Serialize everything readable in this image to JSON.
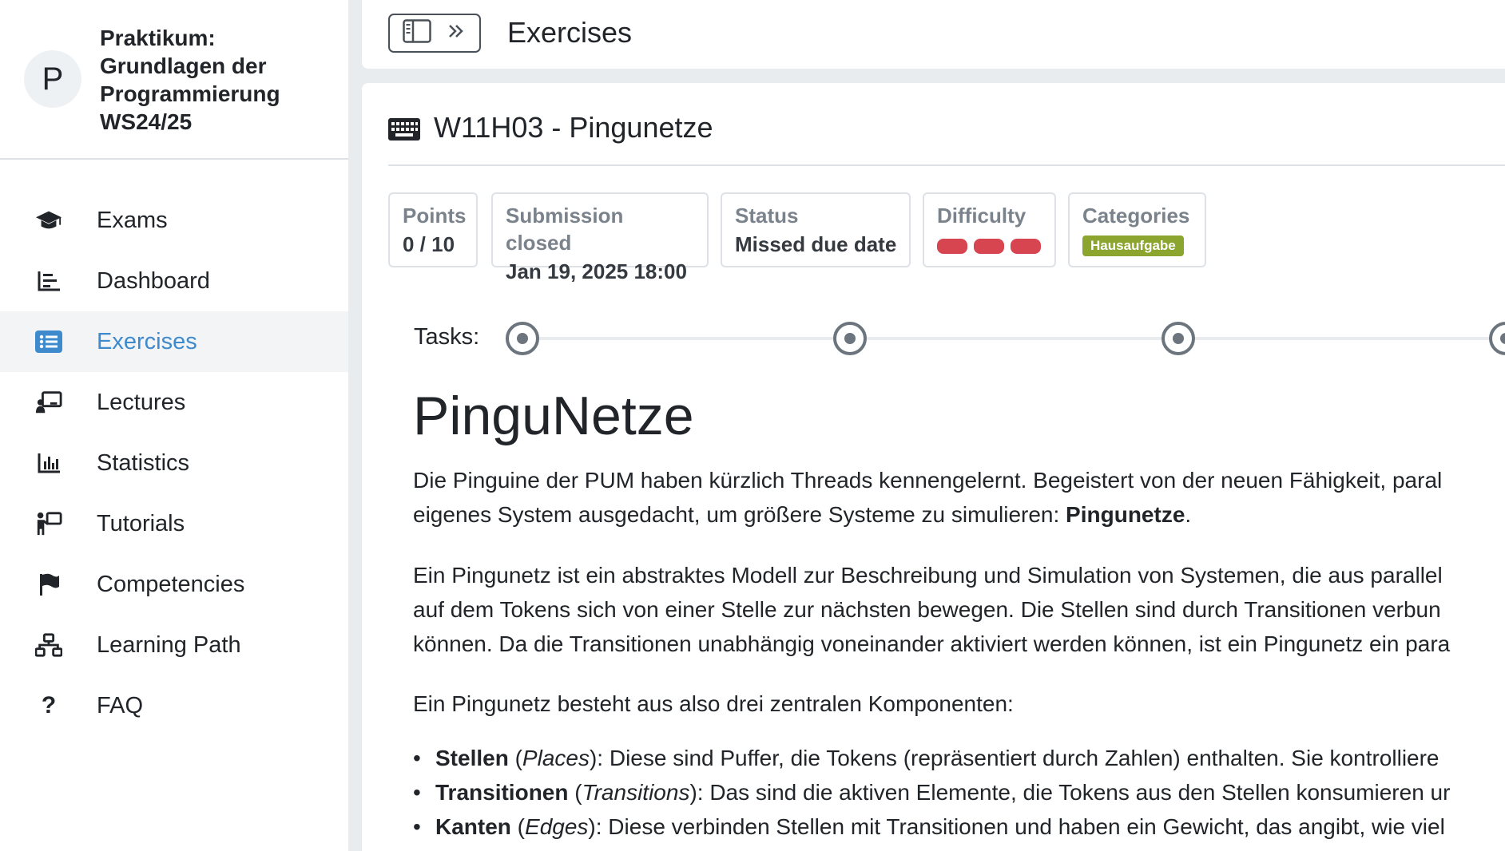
{
  "course": {
    "avatar_letter": "P",
    "title": "Praktikum: Grundlagen der Programmierung WS24/25"
  },
  "sidebar": {
    "items": [
      {
        "label": "Exams",
        "icon": "graduation-cap-icon"
      },
      {
        "label": "Dashboard",
        "icon": "chart-area-icon"
      },
      {
        "label": "Exercises",
        "icon": "list-icon",
        "active": true
      },
      {
        "label": "Lectures",
        "icon": "chalkboard-user-icon"
      },
      {
        "label": "Statistics",
        "icon": "bar-chart-icon"
      },
      {
        "label": "Tutorials",
        "icon": "person-chalkboard-icon"
      },
      {
        "label": "Competencies",
        "icon": "flag-icon"
      },
      {
        "label": "Learning Path",
        "icon": "sitemap-icon"
      },
      {
        "label": "FAQ",
        "icon": "question-icon"
      }
    ],
    "active_color": "#3e8acc"
  },
  "topbar": {
    "title": "Exercises"
  },
  "exercise": {
    "title": "W11H03 - Pingunetze",
    "info": {
      "points_label": "Points",
      "points_value": "0 / 10",
      "submission_label": "Submission closed",
      "submission_value": "Jan 19, 2025 18:00",
      "status_label": "Status",
      "status_value": "Missed due date",
      "difficulty_label": "Difficulty",
      "difficulty_level": 3,
      "difficulty_color": "#d64550",
      "categories_label": "Categories",
      "category_badge": "Hausaufgabe",
      "badge_color": "#8ba52f"
    },
    "tasks_label": "Tasks:"
  },
  "problem": {
    "heading": "PinguNetze",
    "p1_line1": "Die Pinguine der PUM haben kürzlich Threads kennengelernt. Begeistert von der neuen Fähigkeit, paral",
    "p1_line2_start": "eigenes System ausgedacht, um größere Systeme zu simulieren: ",
    "p1_line2_bold": "Pingunetze",
    "p1_line2_end": ".",
    "p2_line1": "Ein Pingunetz ist ein abstraktes Modell zur Beschreibung und Simulation von Systemen, die aus parallel",
    "p2_line2": "auf dem Tokens sich von einer Stelle zur nächsten bewegen. Die Stellen sind durch Transitionen verbun",
    "p2_line3": "können. Da die Transitionen unabhängig voneinander aktiviert werden können, ist ein Pingunetz ein para",
    "p3": "Ein Pingunetz besteht aus also drei zentralen Komponenten:",
    "bullets": [
      {
        "bold": "Stellen",
        "paren_open": " (",
        "italic": "Places",
        "rest": "): Diese sind Puffer, die Tokens (repräsentiert durch Zahlen) enthalten. Sie kontrolliere"
      },
      {
        "bold": "Transitionen",
        "paren_open": " (",
        "italic": "Transitions",
        "rest": "): Das sind die aktiven Elemente, die Tokens aus den Stellen konsumieren ur"
      },
      {
        "bold": "Kanten",
        "paren_open": " (",
        "italic": "Edges",
        "rest": "): Diese verbinden Stellen mit Transitionen und haben ein Gewicht, das angibt, wie viel"
      }
    ]
  }
}
